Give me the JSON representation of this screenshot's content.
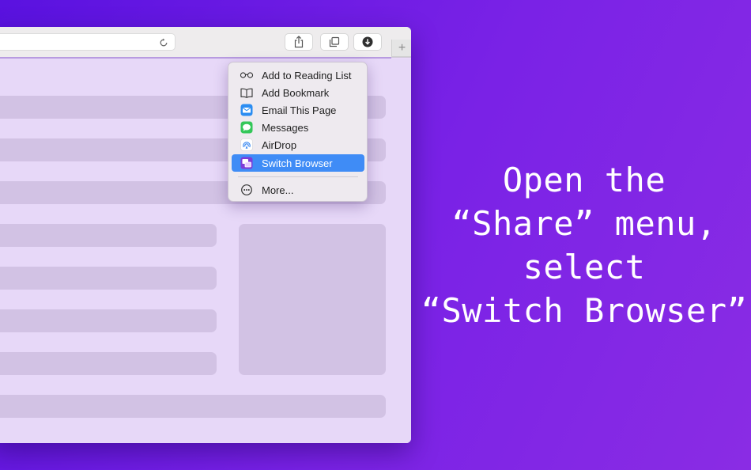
{
  "share_menu": {
    "items": [
      {
        "label": "Add to Reading List",
        "icon": "reading-glasses-icon"
      },
      {
        "label": "Add Bookmark",
        "icon": "book-icon"
      },
      {
        "label": "Email This Page",
        "icon": "mail-icon"
      },
      {
        "label": "Messages",
        "icon": "messages-icon"
      },
      {
        "label": "AirDrop",
        "icon": "airdrop-icon"
      },
      {
        "label": "Switch Browser",
        "icon": "switch-browser-icon",
        "selected": true
      },
      {
        "label": "More...",
        "icon": "more-icon"
      }
    ]
  },
  "toolbar": {
    "buttons": [
      "share-icon",
      "tabs-overview-icon",
      "downloads-icon"
    ],
    "new_tab": "+"
  },
  "caption": {
    "lines": [
      "Open the",
      "“Share” menu,",
      "select",
      "“Switch Browser”"
    ]
  },
  "colors": {
    "background_start": "#5a12e0",
    "background_end": "#8a2ce4",
    "selected": "#3f8cf6",
    "page_background": "#e7d8f8",
    "placeholder": "#d2c2e4"
  }
}
